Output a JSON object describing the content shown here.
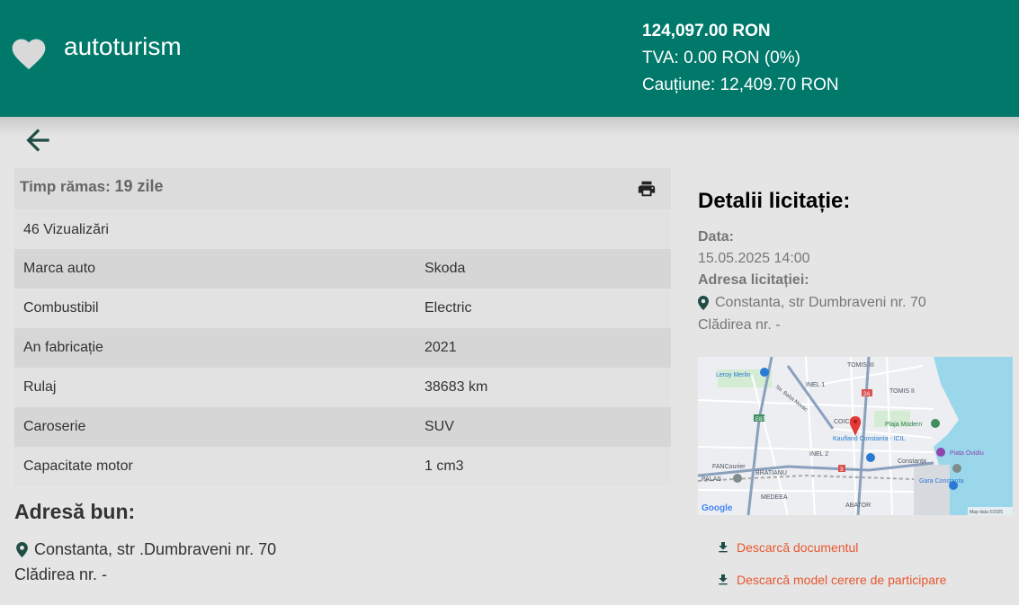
{
  "header": {
    "title": "autoturism",
    "price": "124,097.00 RON",
    "tva": "TVA: 0.00 RON (0%)",
    "caution": "Cauțiune: 12,409.70 RON",
    "bg_color": "#00796b"
  },
  "icons": {
    "favorite": "heart-icon",
    "back": "arrow-left-icon",
    "print": "printer-icon",
    "location": "map-marker-icon",
    "download": "download-icon"
  },
  "timer": {
    "label": "Timp rămas:",
    "value": "19 zile"
  },
  "views": "46 Vizualizări",
  "specs": [
    {
      "key": "Marca auto",
      "value": "Skoda"
    },
    {
      "key": "Combustibil",
      "value": "Electric"
    },
    {
      "key": "An fabricație",
      "value": "2021"
    },
    {
      "key": "Rulaj",
      "value": "38683 km"
    },
    {
      "key": "Caroserie",
      "value": "SUV"
    },
    {
      "key": "Capacitate motor",
      "value": "1 cm3"
    }
  ],
  "asset_address": {
    "title": "Adresă bun:",
    "address": "Constanta, str .Dumbraveni nr. 70",
    "building": "Clădirea nr. -"
  },
  "auction": {
    "title": "Detalii licitație:",
    "date_label": "Data:",
    "date_value": "15.05.2025 14:00",
    "address_label": "Adresa licitației:",
    "address": "Constanta, str Dumbraveni nr. 70",
    "building": "Clădirea nr. -"
  },
  "map": {
    "labels": [
      "TOMIS III",
      "TOMIS II",
      "Leroy Merlin",
      "INEL 1",
      "Str. Baba Novac",
      "COICI",
      "Plaja Modern",
      "Kaufland Constanta - ICIL",
      "INEL 2",
      "Piața Ovidiu",
      "Constanța",
      "FANCourier",
      "BRATIANU",
      "PALAS",
      "Gara Constanta",
      "MEDEEA",
      "ABATOR",
      "Google",
      "Map data ©2025",
      "E87",
      "2A",
      "3"
    ]
  },
  "downloads": {
    "document": "Descarcă documentul",
    "model": "Descarcă model cerere de participare",
    "link_color": "#e8572f"
  }
}
